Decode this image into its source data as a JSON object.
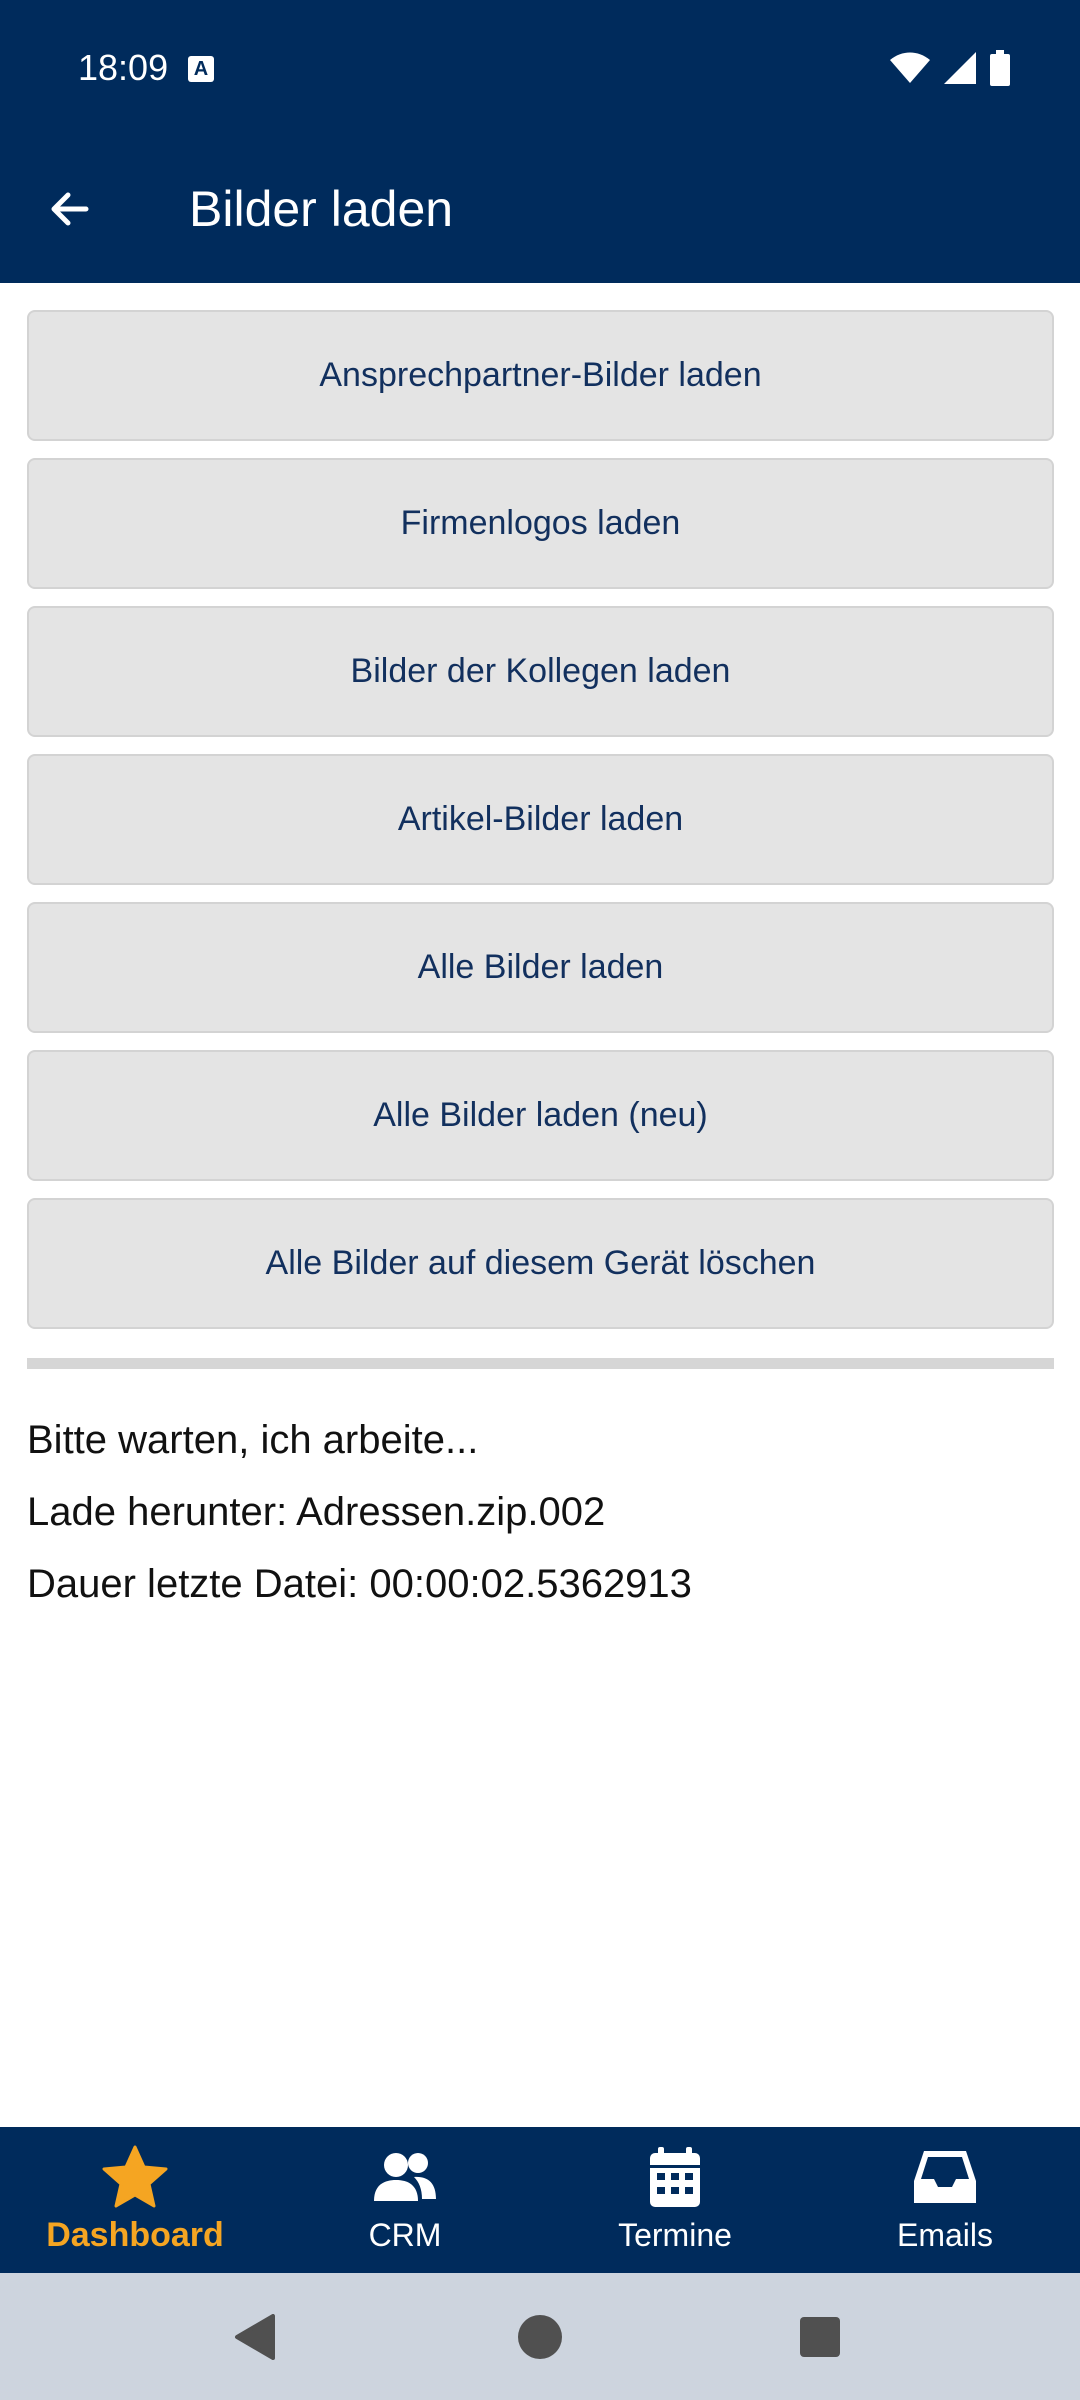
{
  "status_bar": {
    "time": "18:09",
    "notification_icon": "a-box-icon"
  },
  "app_bar": {
    "title": "Bilder laden",
    "back_icon": "arrow-left-icon"
  },
  "buttons": [
    {
      "label": "Ansprechpartner-Bilder laden"
    },
    {
      "label": "Firmenlogos laden"
    },
    {
      "label": "Bilder der Kollegen laden"
    },
    {
      "label": "Artikel-Bilder laden"
    },
    {
      "label": "Alle Bilder laden"
    },
    {
      "label": "Alle Bilder laden (neu)"
    },
    {
      "label": "Alle Bilder auf diesem Gerät löschen"
    }
  ],
  "status": {
    "line1": "Bitte warten, ich arbeite...",
    "line2": "Lade herunter: Adressen.zip.002",
    "line3": "Dauer letzte Datei: 00:00:02.5362913"
  },
  "bottom_nav": [
    {
      "label": "Dashboard",
      "icon": "star-icon",
      "active": true
    },
    {
      "label": "CRM",
      "icon": "people-icon",
      "active": false
    },
    {
      "label": "Termine",
      "icon": "calendar-icon",
      "active": false
    },
    {
      "label": "Emails",
      "icon": "inbox-icon",
      "active": false
    }
  ],
  "colors": {
    "primary": "#002b5c",
    "accent": "#f5a522",
    "button_bg": "#e4e4e4",
    "button_text": "#12305e"
  }
}
